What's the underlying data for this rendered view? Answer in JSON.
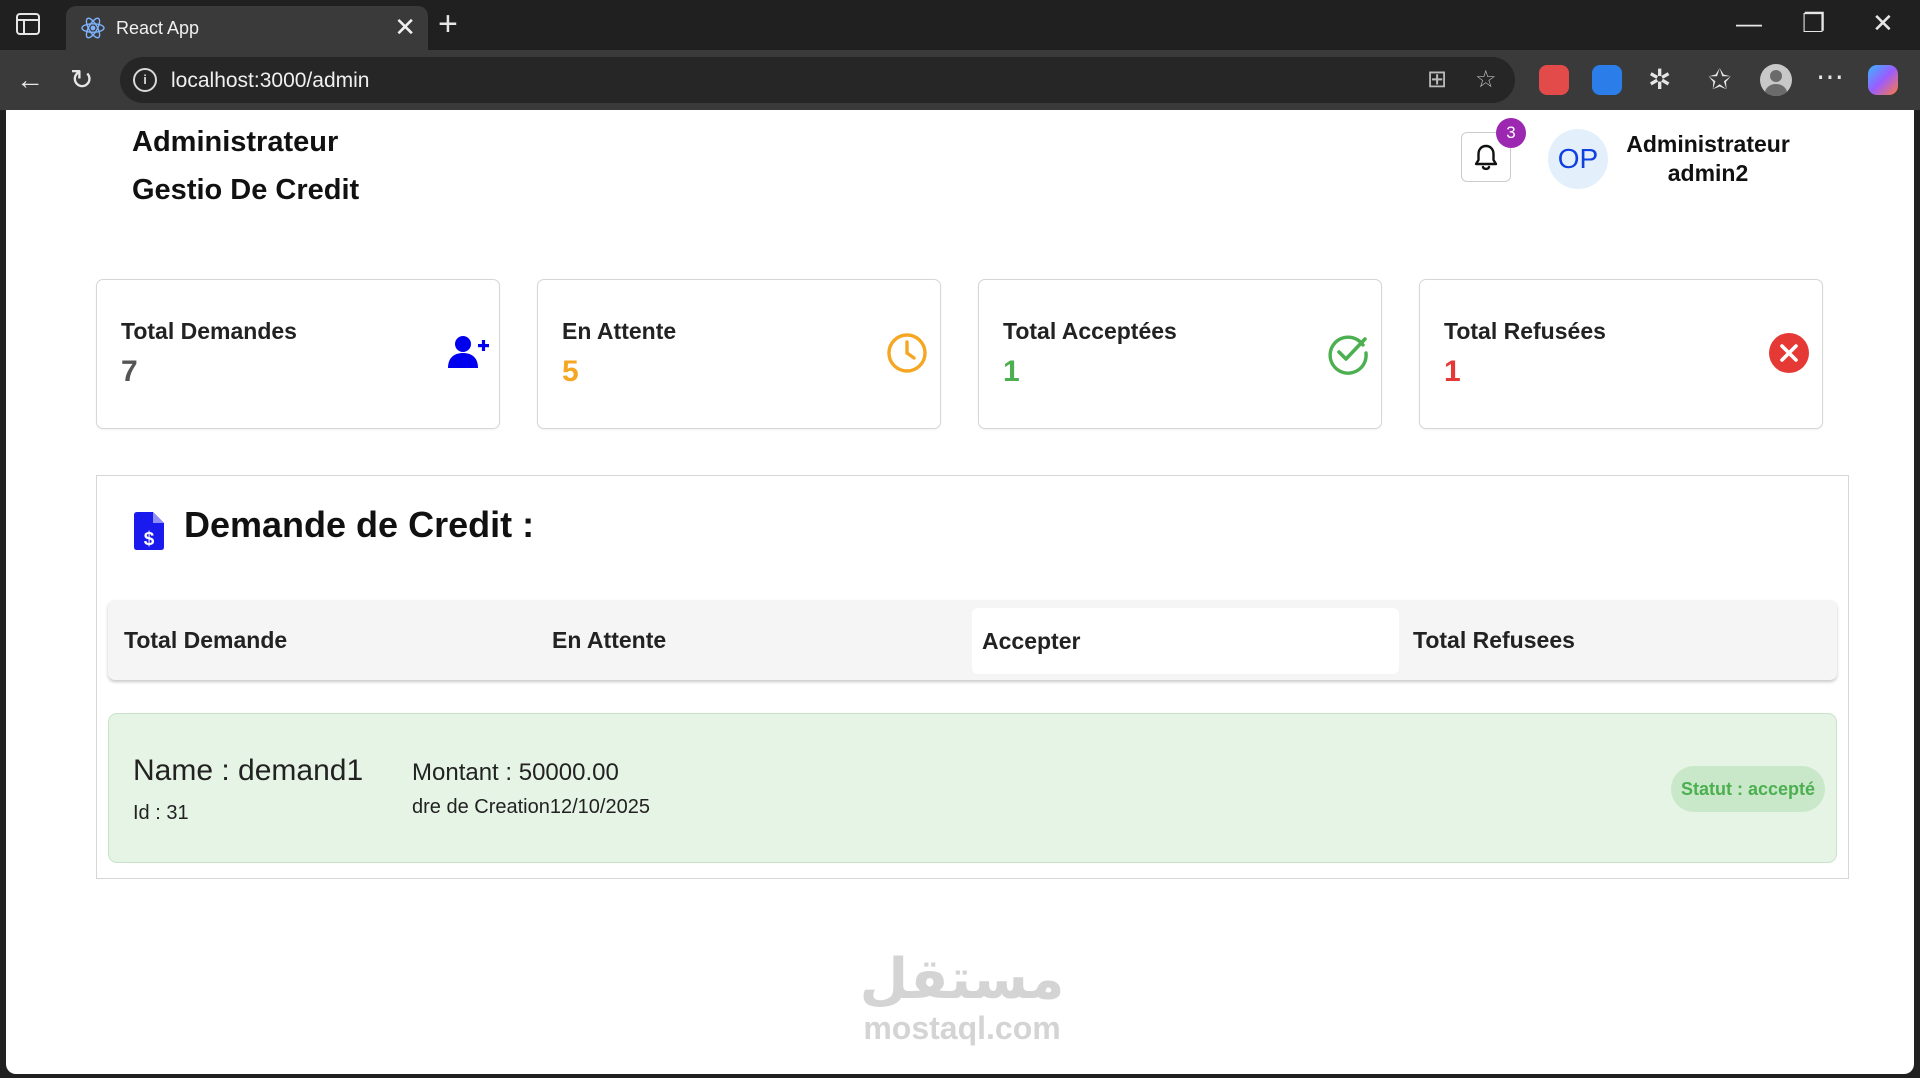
{
  "browser": {
    "tab_title": "React App",
    "url": "localhost:3000/admin"
  },
  "header": {
    "title_line1": "Administrateur",
    "title_line2": "Gestio De Credit",
    "notification_count": "3",
    "avatar_initials": "OP",
    "user_role": "Administrateur",
    "user_name": "admin2"
  },
  "stats": [
    {
      "label": "Total Demandes",
      "value": "7",
      "color": "#555555",
      "icon": "user-plus-icon",
      "icon_color": "#0000ee"
    },
    {
      "label": "En Attente",
      "value": "5",
      "color": "#f5a623",
      "icon": "clock-icon",
      "icon_color": "#f5a623"
    },
    {
      "label": "Total Acceptées",
      "value": "1",
      "color": "#4caf50",
      "icon": "check-circle-icon",
      "icon_color": "#4caf50"
    },
    {
      "label": "Total Refusées",
      "value": "1",
      "color": "#e53935",
      "icon": "cross-circle-icon",
      "icon_color": "#e53935"
    }
  ],
  "panel": {
    "title": "Demande de Credit :",
    "tabs": [
      "Total Demande",
      "En Attente",
      "Accepter",
      "Total Refusees"
    ],
    "active_tab": "Accepter",
    "requests": [
      {
        "name": "Name : demand1",
        "id": "Id : 31",
        "amount": "Montant : 50000.00",
        "date": "dre de Creation12/10/2025",
        "status": "Statut : accepté"
      }
    ]
  },
  "watermark": {
    "arabic": "مستقل",
    "latin": "mostaql.com"
  }
}
